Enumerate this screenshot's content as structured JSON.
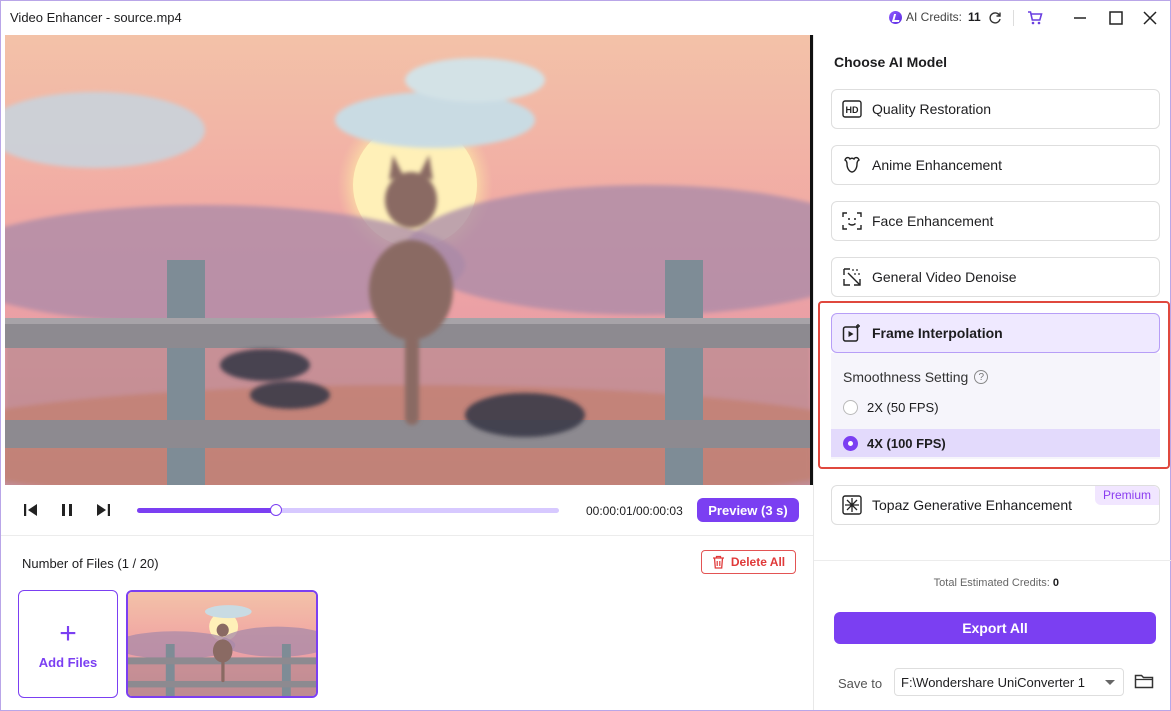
{
  "window": {
    "title": "Video Enhancer - source.mp4"
  },
  "titlebar": {
    "credits_label": "AI Credits:",
    "credits_value": "11",
    "icons": [
      "ai-credits-icon",
      "refresh-icon",
      "cart-icon",
      "minimize-icon",
      "maximize-icon",
      "close-icon"
    ]
  },
  "player": {
    "timecode": "00:00:01/00:00:03",
    "preview_label": "Preview (3 s)",
    "progress_fraction": 0.33
  },
  "files": {
    "count_label": "Number of Files (1 / 20)",
    "delete_all_label": "Delete All",
    "add_files_label": "Add Files"
  },
  "panel": {
    "title": "Choose AI Model",
    "models": [
      {
        "label": "Quality Restoration",
        "icon": "hd-icon"
      },
      {
        "label": "Anime Enhancement",
        "icon": "anime-icon"
      },
      {
        "label": "Face Enhancement",
        "icon": "face-scan-icon"
      },
      {
        "label": "General Video Denoise",
        "icon": "denoise-icon"
      },
      {
        "label": "Frame Interpolation",
        "icon": "frame-interpolation-icon"
      },
      {
        "label": "Topaz Generative Enhancement",
        "icon": "sparkle-icon",
        "badge": "Premium"
      }
    ],
    "smoothness_label": "Smoothness Setting",
    "options": [
      {
        "label": "2X (50 FPS)",
        "selected": false
      },
      {
        "label": "4X (100 FPS)",
        "selected": true
      }
    ],
    "credits_label": "Total Estimated Credits:",
    "credits_value": "0",
    "export_label": "Export All",
    "save_to_label": "Save to",
    "save_to_value": "F:\\Wondershare UniConverter 1"
  },
  "colors": {
    "accent": "#7b3ff2",
    "highlight_border": "#e0483e",
    "selected_bg": "#efe9ff"
  }
}
